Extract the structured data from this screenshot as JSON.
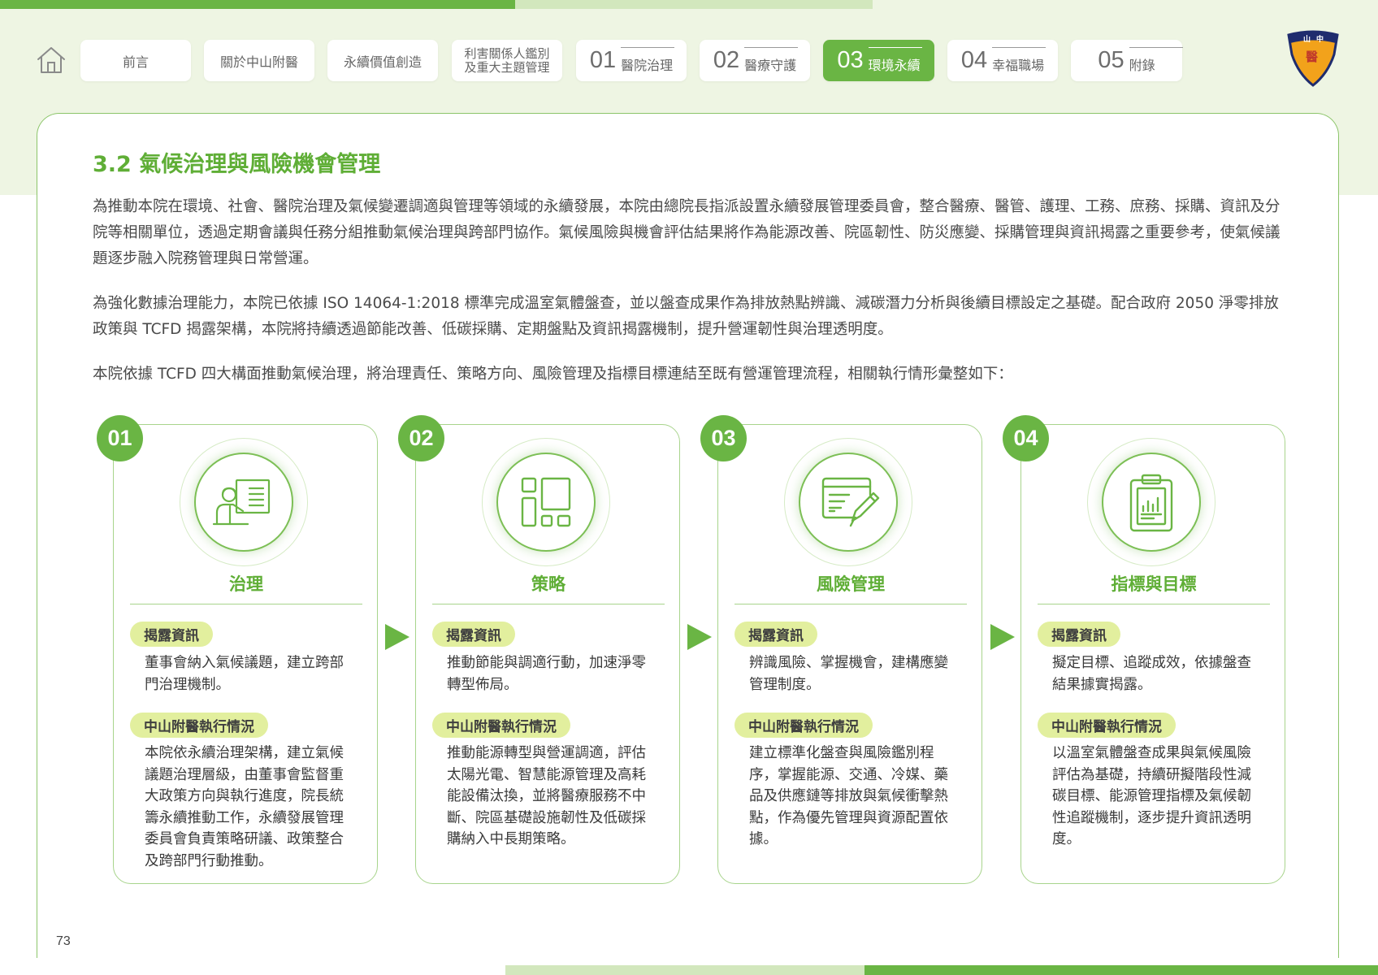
{
  "colors": {
    "accent": "#6ab544",
    "accent_light": "#d2e7bd",
    "band": "#eef5e3",
    "pill": "#e2ef9e"
  },
  "nav": {
    "home_icon": "home-icon",
    "tabs": [
      {
        "label": "前言"
      },
      {
        "label": "關於中山附醫"
      },
      {
        "label": "永續價值創造"
      },
      {
        "line1": "利害關係人鑑別",
        "line2": "及重大主題管理"
      },
      {
        "num": "01",
        "label": "醫院治理"
      },
      {
        "num": "02",
        "label": "醫療守護"
      },
      {
        "num": "03",
        "label": "環境永續",
        "active": true
      },
      {
        "num": "04",
        "label": "幸福職場"
      },
      {
        "num": "05",
        "label": "附錄"
      }
    ],
    "logo_icon": "hospital-emblem-icon",
    "logo_text": "中山醫"
  },
  "section": {
    "title": "3.2 氣候治理與風險機會管理",
    "paragraphs": [
      "為推動本院在環境、社會、醫院治理及氣候變遷調適與管理等領域的永續發展，本院由總院長指派設置永續發展管理委員會，整合醫療、醫管、護理、工務、庶務、採購、資訊及分院等相關單位，透過定期會議與任務分組推動氣候治理與跨部門協作。氣候風險與機會評估結果將作為能源改善、院區韌性、防災應變、採購管理與資訊揭露之重要參考，使氣候議題逐步融入院務管理與日常營運。",
      "為強化數據治理能力，本院已依據 ISO 14064-1:2018 標準完成溫室氣體盤查，並以盤查成果作為排放熱點辨識、減碳潛力分析與後續目標設定之基礎。配合政府 2050 淨零排放政策與 TCFD 揭露架構，本院將持續透過節能改善、低碳採購、定期盤點及資訊揭露機制，提升營運韌性與治理透明度。",
      "本院依據 TCFD 四大構面推動氣候治理，將治理責任、策略方向、風險管理及指標目標連結至既有營運管理流程，相關執行情形彙整如下："
    ]
  },
  "steps": [
    {
      "num": "01",
      "icon": "presentation-person-icon",
      "title": "治理",
      "label1": "揭露資訊",
      "text1": "董事會納入氣候議題，建立跨部門治理機制。",
      "label2": "中山附醫執行情況",
      "text2": "本院依永續治理架構，建立氣候議題治理層級，由董事會監督重大政策方向與執行進度，院長統籌永續推動工作，永續發展管理委員會負責策略研議、政策整合及跨部門行動推動。"
    },
    {
      "num": "02",
      "icon": "dashboard-layout-icon",
      "title": "策略",
      "label1": "揭露資訊",
      "text1": "推動節能與調適行動，加速淨零轉型佈局。",
      "label2": "中山附醫執行情況",
      "text2": "推動能源轉型與營運調適，評估太陽光電、智慧能源管理及高耗能設備汰換，並將醫療服務不中斷、院區基礎設施韌性及低碳採購納入中長期策略。"
    },
    {
      "num": "03",
      "icon": "document-edit-icon",
      "title": "風險管理",
      "label1": "揭露資訊",
      "text1": "辨識風險、掌握機會，建構應變管理制度。",
      "label2": "中山附醫執行情況",
      "text2": "建立標準化盤查與風險鑑別程序，掌握能源、交通、冷媒、藥品及供應鏈等排放與氣候衝擊熱點，作為優先管理與資源配置依據。"
    },
    {
      "num": "04",
      "icon": "clipboard-chart-icon",
      "title": "指標與目標",
      "label1": "揭露資訊",
      "text1": "擬定目標、追蹤成效，依據盤查結果據實揭露。",
      "label2": "中山附醫執行情況",
      "text2": "以溫室氣體盤查成果與氣候風險評估為基礎，持續研擬階段性減碳目標、能源管理指標及氣候韌性追蹤機制，逐步提升資訊透明度。"
    }
  ],
  "arrow_icon": "arrow-right-icon",
  "footer": {
    "page_number": "73"
  }
}
